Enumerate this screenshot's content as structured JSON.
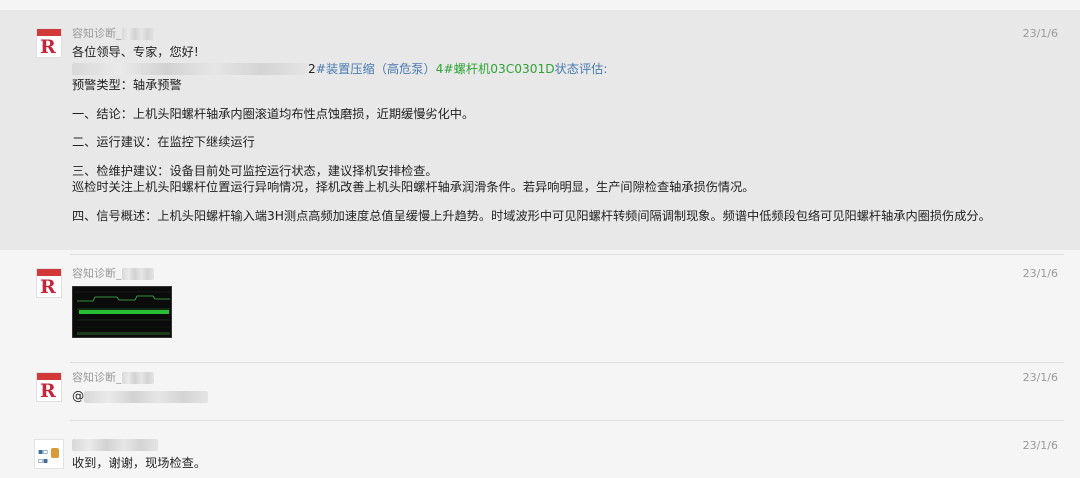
{
  "messages": [
    {
      "sender": "容知诊断_",
      "time": "23/1/6",
      "greeting": "各位领导、专家，您好!",
      "device_line": {
        "prefix": "2",
        "pump": "#装置压缩（高危泵）",
        "machine": "4#螺杆机03C0301D",
        "suffix": "状态评估:"
      },
      "alarm_type": "预警类型：轴承预警",
      "conclusion": "一、结论：上机头阳螺杆轴承内圈滚道均布性点蚀磨损，近期缓慢劣化中。",
      "operation": "二、运行建议：在监控下继续运行",
      "maintenance": "三、检维护建议：设备目前处可监控运行状态，建议择机安排检查。",
      "inspection": "巡检时关注上机头阳螺杆位置运行异响情况，择机改善上机头阳螺杆轴承润滑条件。若异响明显，生产间隙检查轴承损伤情况。",
      "signal": "四、信号概述：上机头阳螺杆输入端3H测点高频加速度总值呈缓慢上升趋势。时域波形中可见阳螺杆转频间隔调制现象。频谱中低频段包络可见阳螺杆轴承内圈损伤成分。"
    },
    {
      "sender": "容知诊断_",
      "time": "23/1/6",
      "attachment": "trend-chart-screenshot"
    },
    {
      "sender": "容知诊断_",
      "time": "23/1/6",
      "text": "@"
    },
    {
      "sender": "",
      "time": "23/1/6",
      "text": "收到，谢谢，现场检查。"
    }
  ],
  "colors": {
    "highlight_bg": "#e8e8e8",
    "link_blue": "#4a7ab0",
    "link_green": "#2fa336"
  },
  "icons": {
    "sender_avatar": "company-logo-avatar",
    "reply_avatar": "user-avatar"
  }
}
